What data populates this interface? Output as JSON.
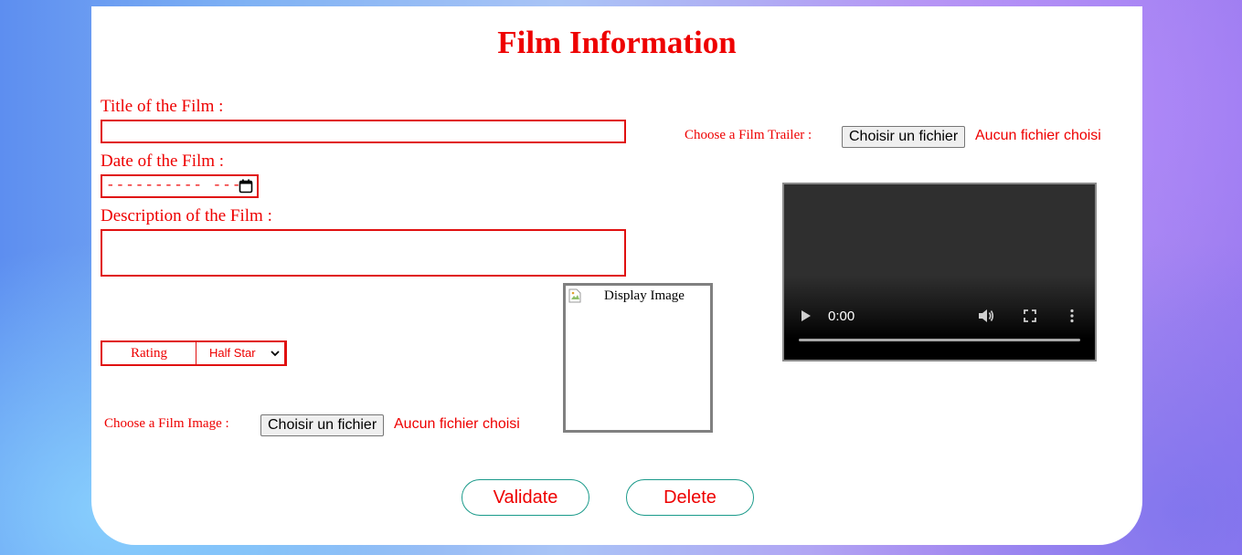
{
  "page": {
    "title": "Film Information"
  },
  "form": {
    "title_label": "Title of the Film :",
    "title_value": "",
    "date_label": "Date of the Film :",
    "date_placeholder": "---------- ---",
    "description_label": "Description of the Film :",
    "description_value": "",
    "rating_label": "Rating",
    "rating_selected": "Half Star",
    "image_label": "Choose a Film Image :",
    "image_button": "Choisir un fichier",
    "image_status": "Aucun fichier choisi",
    "image_alt": "Display Image",
    "trailer_label": "Choose a Film Trailer :",
    "trailer_button": "Choisir un fichier",
    "trailer_status": "Aucun fichier choisi"
  },
  "video": {
    "time": "0:00",
    "progress": 0
  },
  "actions": {
    "validate": "Validate",
    "delete": "Delete"
  },
  "colors": {
    "accent": "#ee0000",
    "button_border": "#1a9a8a"
  },
  "icons": [
    "calendar-icon",
    "chevron-down-icon",
    "broken-image-icon",
    "play-icon",
    "volume-icon",
    "fullscreen-icon",
    "more-vert-icon"
  ]
}
